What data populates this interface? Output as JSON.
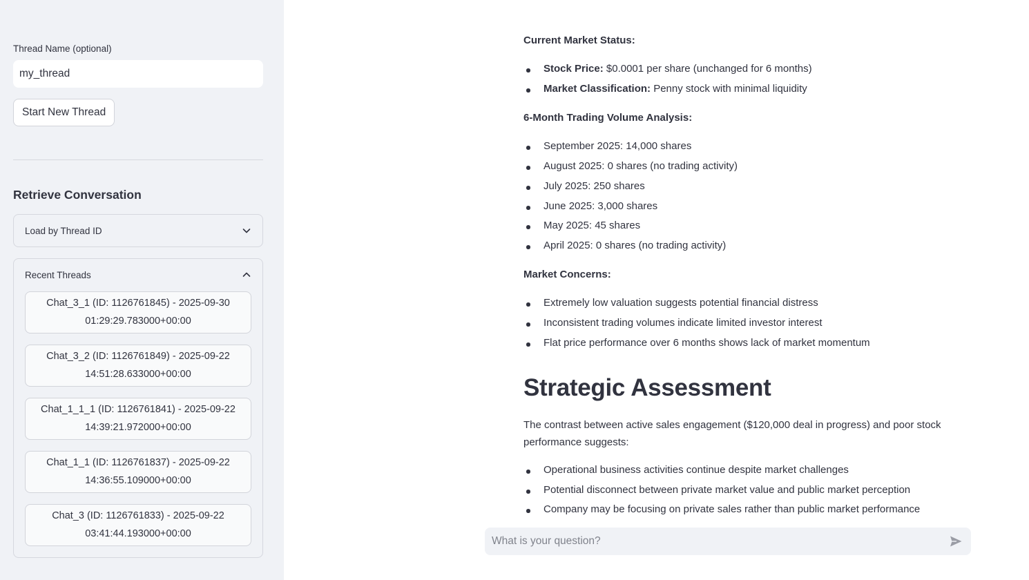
{
  "sidebar": {
    "thread_name_label": "Thread Name (optional)",
    "thread_name_value": "my_thread",
    "start_button": "Start New Thread",
    "retrieve_heading": "Retrieve Conversation",
    "load_expander": "Load by Thread ID",
    "recent_expander": "Recent Threads",
    "threads": [
      {
        "line1": "Chat_3_1 (ID: 1126761845) - 2025-09-30",
        "line2": "01:29:29.783000+00:00"
      },
      {
        "line1": "Chat_3_2 (ID: 1126761849) - 2025-09-22",
        "line2": "14:51:28.633000+00:00"
      },
      {
        "line1": "Chat_1_1_1 (ID: 1126761841) - 2025-09-22",
        "line2": "14:39:21.972000+00:00"
      },
      {
        "line1": "Chat_1_1 (ID: 1126761837) - 2025-09-22",
        "line2": "14:36:55.109000+00:00"
      },
      {
        "line1": "Chat_3 (ID: 1126761833) - 2025-09-22",
        "line2": "03:41:44.193000+00:00"
      }
    ]
  },
  "main": {
    "market_status_heading": "Current Market Status:",
    "market_status_items": [
      {
        "label": "Stock Price:",
        "text": " $0.0001 per share (unchanged for 6 months)"
      },
      {
        "label": "Market Classification:",
        "text": " Penny stock with minimal liquidity"
      }
    ],
    "volume_heading": "6-Month Trading Volume Analysis:",
    "volume_items": [
      "September 2025: 14,000 shares",
      "August 2025: 0 shares (no trading activity)",
      "July 2025: 250 shares",
      "June 2025: 3,000 shares",
      "May 2025: 45 shares",
      "April 2025: 0 shares (no trading activity)"
    ],
    "concerns_heading": "Market Concerns:",
    "concerns_items": [
      "Extremely low valuation suggests potential financial distress",
      "Inconsistent trading volumes indicate limited investor interest",
      "Flat price performance over 6 months shows lack of market momentum"
    ],
    "strategic_heading": "Strategic Assessment",
    "strategic_paragraph": "The contrast between active sales engagement ($120,000 deal in progress) and poor stock performance suggests:",
    "strategic_items": [
      "Operational business activities continue despite market challenges",
      "Potential disconnect between private market value and public market perception",
      "Company may be focusing on private sales rather than public market performance"
    ]
  },
  "chat": {
    "placeholder": "What is your question?"
  },
  "icons": {
    "expander_closed": "chevron-down-icon",
    "expander_open": "chevron-up-icon",
    "send": "send-icon"
  }
}
